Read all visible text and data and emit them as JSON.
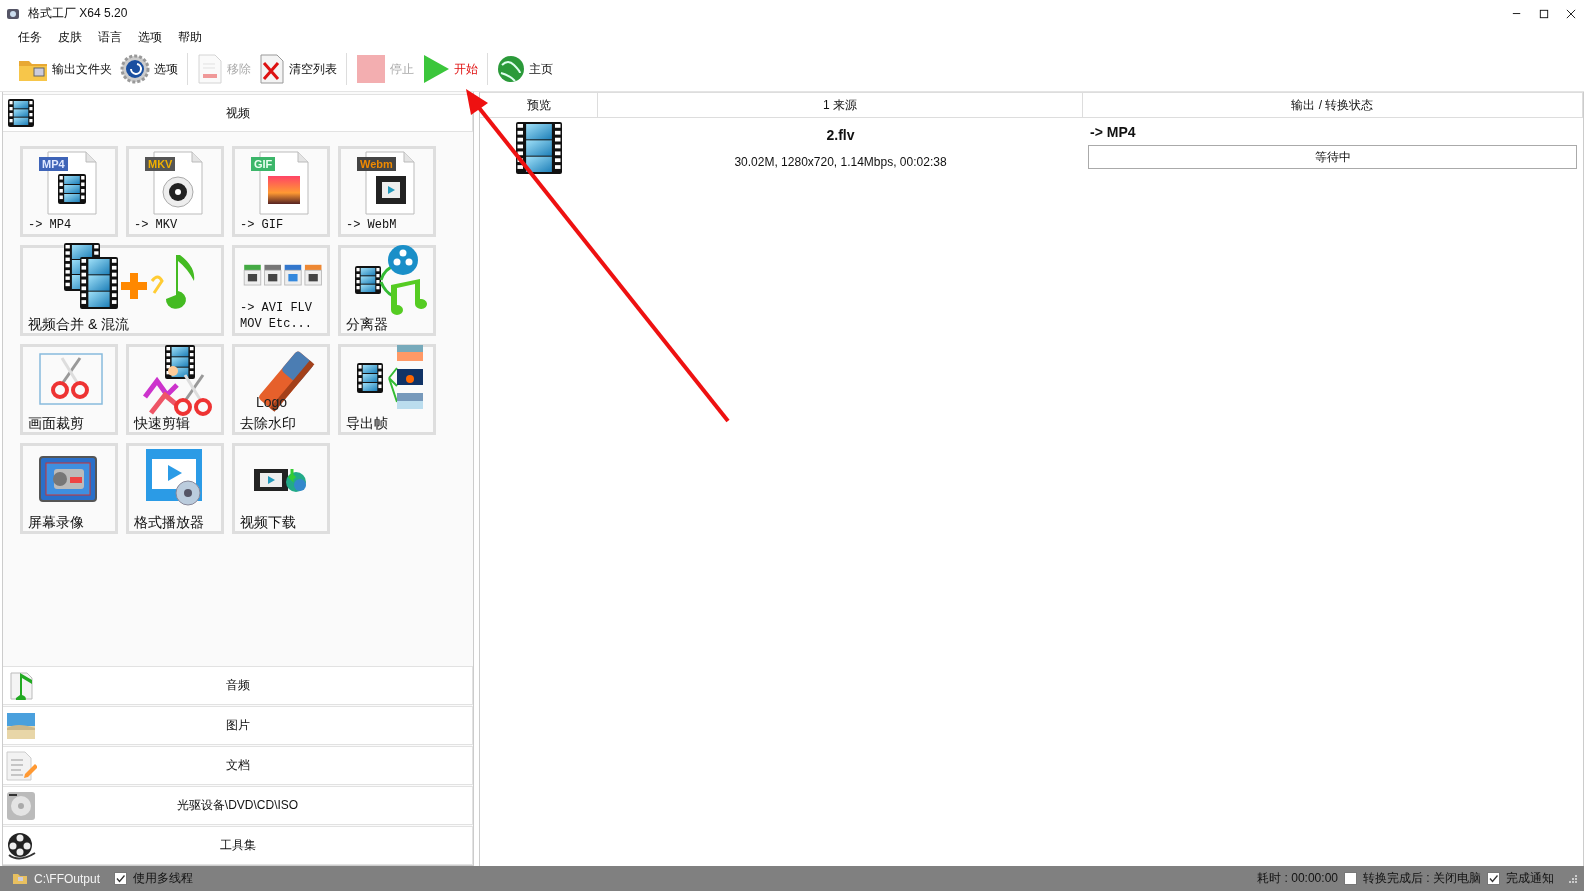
{
  "window": {
    "title": "格式工厂 X64 5.20"
  },
  "menu": [
    {
      "label": "任务"
    },
    {
      "label": "皮肤"
    },
    {
      "label": "语言"
    },
    {
      "label": "选项"
    },
    {
      "label": "帮助"
    }
  ],
  "toolbar": [
    {
      "kind": "folder",
      "label": "输出文件夹",
      "disabled": false,
      "highlighted": false
    },
    {
      "kind": "options",
      "label": "选项",
      "disabled": false,
      "highlighted": false
    },
    {
      "kind": "remove",
      "label": "移除",
      "disabled": true,
      "highlighted": false
    },
    {
      "kind": "clear",
      "label": "清空列表",
      "disabled": false,
      "highlighted": false
    },
    {
      "kind": "stop",
      "label": "停止",
      "disabled": true,
      "highlighted": false
    },
    {
      "kind": "start",
      "label": "开始",
      "disabled": false,
      "highlighted": true
    },
    {
      "kind": "home",
      "label": "主页",
      "disabled": false,
      "highlighted": false
    }
  ],
  "categories": [
    {
      "kind": "video",
      "label": "视频",
      "expanded": true,
      "tiles": [
        {
          "kind": "mp4",
          "label": "-> MP4",
          "badge": "MP4"
        },
        {
          "kind": "mkv",
          "label": "-> MKV",
          "badge": "MKV"
        },
        {
          "kind": "gif",
          "label": "-> GIF",
          "badge": "GIF"
        },
        {
          "kind": "webm",
          "label": "-> WebM",
          "badge": "Webm"
        },
        {
          "kind": "merge",
          "label": "视频合并 & 混流"
        },
        {
          "kind": "formats",
          "label": "-> AVI FLV MOV Etc..."
        },
        {
          "kind": "splitter",
          "label": "分离器"
        },
        {
          "kind": "crop",
          "label": "画面裁剪"
        },
        {
          "kind": "quickcut",
          "label": "快速剪辑"
        },
        {
          "kind": "delogo",
          "label": "去除水印",
          "badge": "Logo"
        },
        {
          "kind": "frames",
          "label": "导出帧"
        },
        {
          "kind": "record",
          "label": "屏幕录像"
        },
        {
          "kind": "player",
          "label": "格式播放器"
        },
        {
          "kind": "download",
          "label": "视频下载"
        }
      ]
    },
    {
      "kind": "audio",
      "label": "音频",
      "expanded": false
    },
    {
      "kind": "image",
      "label": "图片",
      "expanded": false
    },
    {
      "kind": "document",
      "label": "文档",
      "expanded": false
    },
    {
      "kind": "disc",
      "label": "光驱设备\\DVD\\CD\\ISO",
      "expanded": false
    },
    {
      "kind": "tools",
      "label": "工具集",
      "expanded": false
    }
  ],
  "task_list": {
    "columns": [
      "预览",
      "1 来源",
      "输出 / 转换状态"
    ],
    "rows": [
      {
        "source": "2.flv",
        "details": "30.02M, 1280x720, 1.14Mbps, 00:02:38",
        "output": "-> MP4",
        "status": "等待中"
      }
    ]
  },
  "status_bar": {
    "output_folder": "C:\\FFOutput",
    "multithread": {
      "label": "使用多线程",
      "checked": true
    },
    "elapsed": "耗时 : 00:00:00",
    "shutdown": {
      "label": "转换完成后 : 关闭电脑",
      "checked": false
    },
    "notify": {
      "label": "完成通知",
      "checked": true
    }
  },
  "annotations": [
    {
      "kind": "arrow"
    }
  ]
}
